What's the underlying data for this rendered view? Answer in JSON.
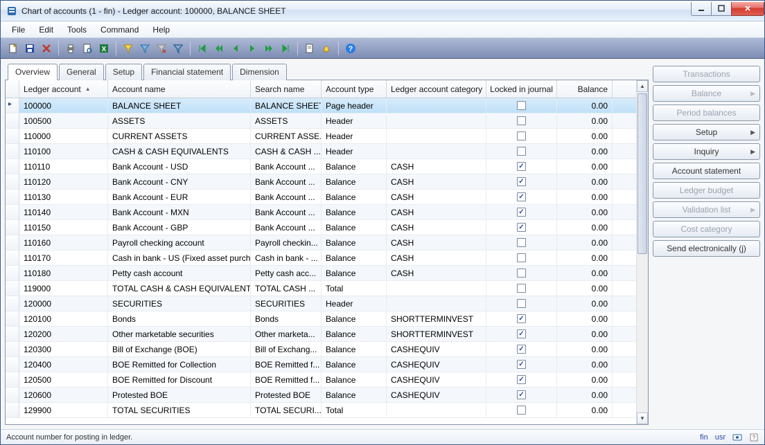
{
  "window": {
    "title": "Chart of accounts (1 - fin) - Ledger account: 100000, BALANCE SHEET"
  },
  "menu": [
    "File",
    "Edit",
    "Tools",
    "Command",
    "Help"
  ],
  "tabs": [
    "Overview",
    "General",
    "Setup",
    "Financial statement",
    "Dimension"
  ],
  "columns": {
    "ledger": "Ledger account",
    "name": "Account name",
    "search": "Search name",
    "type": "Account type",
    "category": "Ledger account category",
    "locked": "Locked in journal",
    "balance": "Balance"
  },
  "rows": [
    {
      "ledger": "100000",
      "name": "BALANCE SHEET",
      "search": "BALANCE SHEET",
      "type": "Page header",
      "category": "",
      "locked": false,
      "balance": "0.00",
      "selected": true
    },
    {
      "ledger": "100500",
      "name": "ASSETS",
      "search": "ASSETS",
      "type": "Header",
      "category": "",
      "locked": false,
      "balance": "0.00"
    },
    {
      "ledger": "110000",
      "name": "CURRENT ASSETS",
      "search": "CURRENT ASSE...",
      "type": "Header",
      "category": "",
      "locked": false,
      "balance": "0.00"
    },
    {
      "ledger": "110100",
      "name": "CASH & CASH EQUIVALENTS",
      "search": "CASH & CASH ...",
      "type": "Header",
      "category": "",
      "locked": false,
      "balance": "0.00"
    },
    {
      "ledger": "110110",
      "name": "Bank Account - USD",
      "search": "Bank Account ...",
      "type": "Balance",
      "category": "CASH",
      "locked": true,
      "balance": "0.00"
    },
    {
      "ledger": "110120",
      "name": "Bank Account - CNY",
      "search": "Bank Account ...",
      "type": "Balance",
      "category": "CASH",
      "locked": true,
      "balance": "0.00"
    },
    {
      "ledger": "110130",
      "name": "Bank Account - EUR",
      "search": "Bank Account ...",
      "type": "Balance",
      "category": "CASH",
      "locked": true,
      "balance": "0.00"
    },
    {
      "ledger": "110140",
      "name": "Bank Account - MXN",
      "search": "Bank Account ...",
      "type": "Balance",
      "category": "CASH",
      "locked": true,
      "balance": "0.00"
    },
    {
      "ledger": "110150",
      "name": "Bank Account - GBP",
      "search": "Bank Account ...",
      "type": "Balance",
      "category": "CASH",
      "locked": true,
      "balance": "0.00"
    },
    {
      "ledger": "110160",
      "name": "Payroll checking account",
      "search": "Payroll checkin...",
      "type": "Balance",
      "category": "CASH",
      "locked": false,
      "balance": "0.00"
    },
    {
      "ledger": "110170",
      "name": "Cash in bank - US (Fixed asset purch)",
      "search": "Cash in bank - ...",
      "type": "Balance",
      "category": "CASH",
      "locked": false,
      "balance": "0.00"
    },
    {
      "ledger": "110180",
      "name": "Petty cash account",
      "search": "Petty cash acc...",
      "type": "Balance",
      "category": "CASH",
      "locked": false,
      "balance": "0.00"
    },
    {
      "ledger": "119000",
      "name": "TOTAL CASH & CASH EQUIVALENTS",
      "search": "TOTAL CASH ...",
      "type": "Total",
      "category": "",
      "locked": false,
      "balance": "0.00"
    },
    {
      "ledger": "120000",
      "name": "SECURITIES",
      "search": "SECURITIES",
      "type": "Header",
      "category": "",
      "locked": false,
      "balance": "0.00"
    },
    {
      "ledger": "120100",
      "name": "Bonds",
      "search": "Bonds",
      "type": "Balance",
      "category": "SHORTTERMINVEST",
      "locked": true,
      "balance": "0.00"
    },
    {
      "ledger": "120200",
      "name": "Other marketable securities",
      "search": "Other marketa...",
      "type": "Balance",
      "category": "SHORTTERMINVEST",
      "locked": true,
      "balance": "0.00"
    },
    {
      "ledger": "120300",
      "name": "Bill of Exchange (BOE)",
      "search": "Bill of Exchang...",
      "type": "Balance",
      "category": "CASHEQUIV",
      "locked": true,
      "balance": "0.00"
    },
    {
      "ledger": "120400",
      "name": "BOE Remitted for Collection",
      "search": "BOE Remitted f...",
      "type": "Balance",
      "category": "CASHEQUIV",
      "locked": true,
      "balance": "0.00"
    },
    {
      "ledger": "120500",
      "name": "BOE Remitted for Discount",
      "search": "BOE Remitted f...",
      "type": "Balance",
      "category": "CASHEQUIV",
      "locked": true,
      "balance": "0.00"
    },
    {
      "ledger": "120600",
      "name": "Protested BOE",
      "search": "Protested BOE",
      "type": "Balance",
      "category": "CASHEQUIV",
      "locked": true,
      "balance": "0.00"
    },
    {
      "ledger": "129900",
      "name": "TOTAL SECURITIES",
      "search": "TOTAL SECURI...",
      "type": "Total",
      "category": "",
      "locked": false,
      "balance": "0.00"
    }
  ],
  "sidebar": [
    {
      "label": "Transactions",
      "disabled": true
    },
    {
      "label": "Balance",
      "disabled": true,
      "submenu": true
    },
    {
      "label": "Period balances",
      "disabled": true
    },
    {
      "label": "Setup",
      "disabled": false,
      "submenu": true
    },
    {
      "label": "Inquiry",
      "disabled": false,
      "submenu": true
    },
    {
      "label": "Account statement",
      "disabled": false
    },
    {
      "label": "Ledger budget",
      "disabled": true
    },
    {
      "label": "Validation list",
      "disabled": true,
      "submenu": true
    },
    {
      "label": "Cost category",
      "disabled": true
    },
    {
      "label": "Send electronically (j)",
      "disabled": false
    }
  ],
  "status": {
    "hint": "Account number for posting in ledger.",
    "indicators": [
      "fin",
      "usr"
    ]
  }
}
